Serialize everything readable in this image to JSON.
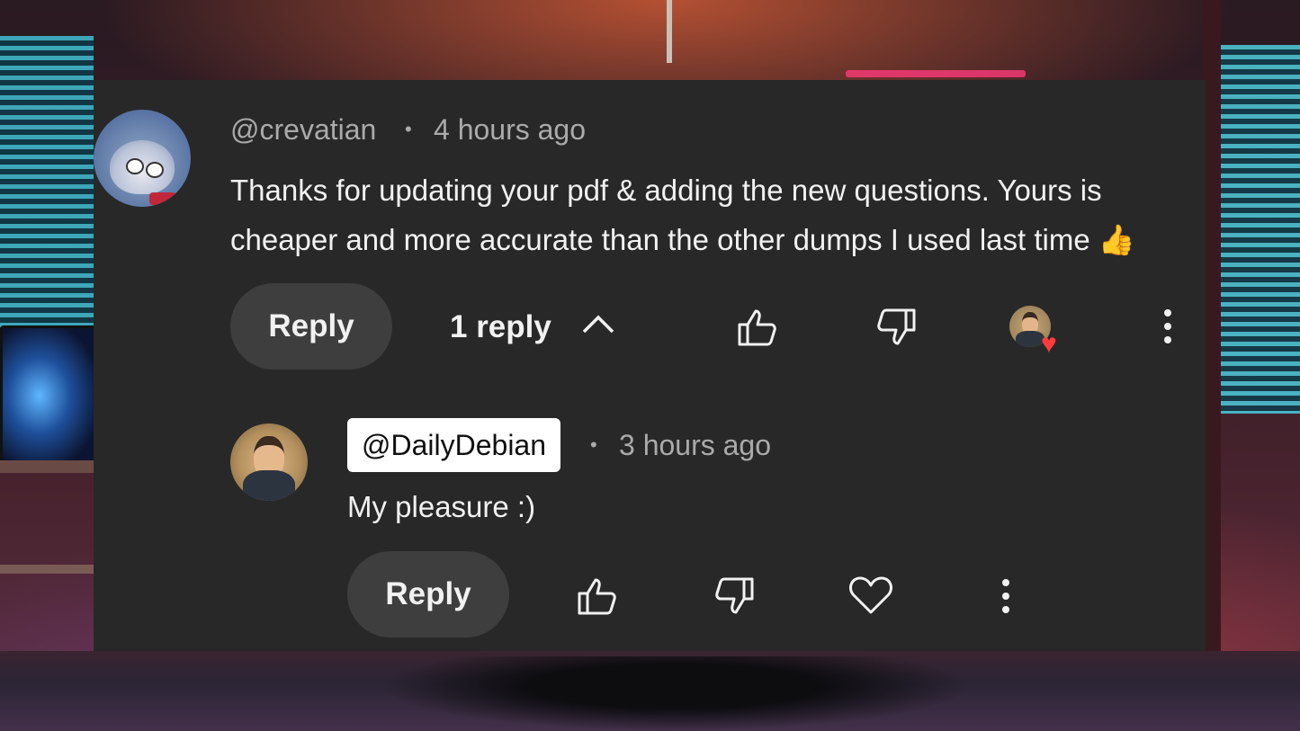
{
  "comment": {
    "author": "@crevatian",
    "separator": "•",
    "time": "4 hours ago",
    "text": "Thanks for updating your pdf & adding the new questions. Yours is cheaper and more accurate than the other dumps I used last time",
    "emoji": "👍",
    "reply_label": "Reply",
    "replies_count_label": "1 reply",
    "icons": [
      "avatar",
      "chevron-up-icon",
      "thumbs-up-icon",
      "thumbs-down-icon",
      "creator-heart-icon",
      "more-vert-icon"
    ]
  },
  "reply": {
    "author": "@DailyDebian",
    "separator": "•",
    "time": "3 hours ago",
    "text": "My pleasure :)",
    "reply_label": "Reply",
    "icons": [
      "avatar",
      "thumbs-up-icon",
      "thumbs-down-icon",
      "heart-outline-icon",
      "more-vert-icon"
    ]
  },
  "colors": {
    "card": "#282828",
    "button": "#3e3e3e",
    "text": "#f1f1f1",
    "meta": "#aaaaaa",
    "heart": "#ff3b3b"
  }
}
